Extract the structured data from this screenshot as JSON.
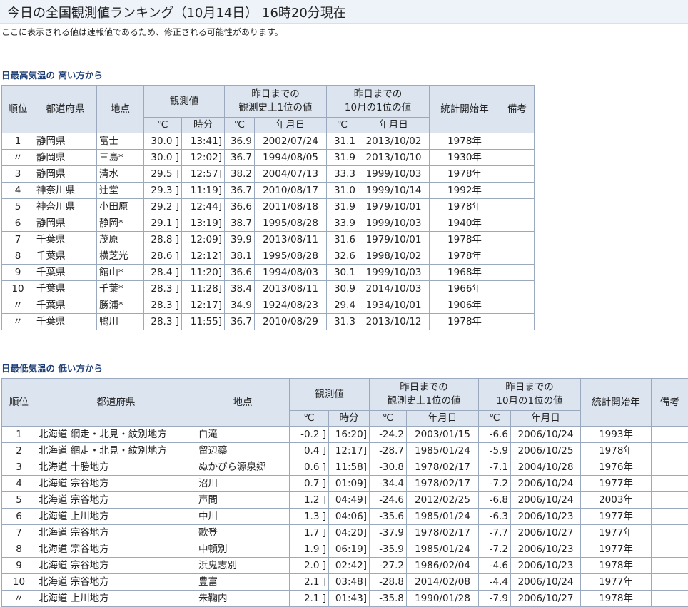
{
  "page": {
    "title": "今日の全国観測値ランキング（10月14日） 16時20分現在",
    "notice": "ここに表示される値は速報値であるため、修正される可能性があります。"
  },
  "headers": {
    "rank": "順位",
    "pref": "都道府県",
    "site": "地点",
    "obs": "観測値",
    "hist_line1": "昨日までの",
    "hist_line2": "観測史上1位の値",
    "oct_line1": "昨日までの",
    "oct_line2": "10月の1位の値",
    "start": "統計開始年",
    "notes": "備考",
    "deg": "℃",
    "time": "時分",
    "date": "年月日"
  },
  "high": {
    "heading": "日最高気温の 高い方から",
    "rows": [
      {
        "rank": "1",
        "pref": "静岡県",
        "site": "富士",
        "val": "30.0 ]",
        "time": "13:41]",
        "hist_val": "36.9",
        "hist_date": "2002/07/24",
        "oct_val": "31.1",
        "oct_date": "2013/10/02",
        "start": "1978年",
        "note": ""
      },
      {
        "rank": "〃",
        "pref": "静岡県",
        "site": "三島*",
        "val": "30.0 ]",
        "time": "12:02]",
        "hist_val": "36.7",
        "hist_date": "1994/08/05",
        "oct_val": "31.9",
        "oct_date": "2013/10/10",
        "start": "1930年",
        "note": ""
      },
      {
        "rank": "3",
        "pref": "静岡県",
        "site": "清水",
        "val": "29.5 ]",
        "time": "12:57]",
        "hist_val": "38.2",
        "hist_date": "2004/07/13",
        "oct_val": "33.3",
        "oct_date": "1999/10/03",
        "start": "1978年",
        "note": ""
      },
      {
        "rank": "4",
        "pref": "神奈川県",
        "site": "辻堂",
        "val": "29.3 ]",
        "time": "11:19]",
        "hist_val": "36.7",
        "hist_date": "2010/08/17",
        "oct_val": "31.0",
        "oct_date": "1999/10/14",
        "start": "1992年",
        "note": ""
      },
      {
        "rank": "5",
        "pref": "神奈川県",
        "site": "小田原",
        "val": "29.2 ]",
        "time": "12:44]",
        "hist_val": "36.6",
        "hist_date": "2011/08/18",
        "oct_val": "31.9",
        "oct_date": "1979/10/01",
        "start": "1978年",
        "note": ""
      },
      {
        "rank": "6",
        "pref": "静岡県",
        "site": "静岡*",
        "val": "29.1 ]",
        "time": "13:19]",
        "hist_val": "38.7",
        "hist_date": "1995/08/28",
        "oct_val": "33.9",
        "oct_date": "1999/10/03",
        "start": "1940年",
        "note": ""
      },
      {
        "rank": "7",
        "pref": "千葉県",
        "site": "茂原",
        "val": "28.8 ]",
        "time": "12:09]",
        "hist_val": "39.9",
        "hist_date": "2013/08/11",
        "oct_val": "31.6",
        "oct_date": "1979/10/01",
        "start": "1978年",
        "note": ""
      },
      {
        "rank": "8",
        "pref": "千葉県",
        "site": "横芝光",
        "val": "28.6 ]",
        "time": "12:12]",
        "hist_val": "38.1",
        "hist_date": "1995/08/28",
        "oct_val": "32.6",
        "oct_date": "1998/10/02",
        "start": "1978年",
        "note": ""
      },
      {
        "rank": "9",
        "pref": "千葉県",
        "site": "館山*",
        "val": "28.4 ]",
        "time": "11:20]",
        "hist_val": "36.6",
        "hist_date": "1994/08/03",
        "oct_val": "30.1",
        "oct_date": "1999/10/03",
        "start": "1968年",
        "note": ""
      },
      {
        "rank": "10",
        "pref": "千葉県",
        "site": "千葉*",
        "val": "28.3 ]",
        "time": "11:28]",
        "hist_val": "38.4",
        "hist_date": "2013/08/11",
        "oct_val": "30.9",
        "oct_date": "2014/10/03",
        "start": "1966年",
        "note": ""
      },
      {
        "rank": "〃",
        "pref": "千葉県",
        "site": "勝浦*",
        "val": "28.3 ]",
        "time": "12:17]",
        "hist_val": "34.9",
        "hist_date": "1924/08/23",
        "oct_val": "29.4",
        "oct_date": "1934/10/01",
        "start": "1906年",
        "note": ""
      },
      {
        "rank": "〃",
        "pref": "千葉県",
        "site": "鴨川",
        "val": "28.3 ]",
        "time": "11:55]",
        "hist_val": "36.7",
        "hist_date": "2010/08/29",
        "oct_val": "31.3",
        "oct_date": "2013/10/12",
        "start": "1978年",
        "note": ""
      }
    ]
  },
  "low": {
    "heading": "日最低気温の 低い方から",
    "rows": [
      {
        "rank": "1",
        "pref": "北海道 網走・北見・紋別地方",
        "site": "白滝",
        "val": "-0.2 ]",
        "time": "16:20]",
        "hist_val": "-24.2",
        "hist_date": "2003/01/15",
        "oct_val": "-6.6",
        "oct_date": "2006/10/24",
        "start": "1993年",
        "note": ""
      },
      {
        "rank": "2",
        "pref": "北海道 網走・北見・紋別地方",
        "site": "留辺蘂",
        "val": "0.4 ]",
        "time": "12:17]",
        "hist_val": "-28.7",
        "hist_date": "1985/01/24",
        "oct_val": "-5.9",
        "oct_date": "2006/10/25",
        "start": "1978年",
        "note": ""
      },
      {
        "rank": "3",
        "pref": "北海道 十勝地方",
        "site": "ぬかびら源泉郷",
        "val": "0.6 ]",
        "time": "11:58]",
        "hist_val": "-30.8",
        "hist_date": "1978/02/17",
        "oct_val": "-7.1",
        "oct_date": "2004/10/28",
        "start": "1976年",
        "note": ""
      },
      {
        "rank": "4",
        "pref": "北海道 宗谷地方",
        "site": "沼川",
        "val": "0.7 ]",
        "time": "01:09]",
        "hist_val": "-34.4",
        "hist_date": "1978/02/17",
        "oct_val": "-7.2",
        "oct_date": "2006/10/24",
        "start": "1977年",
        "note": ""
      },
      {
        "rank": "5",
        "pref": "北海道 宗谷地方",
        "site": "声問",
        "val": "1.2 ]",
        "time": "04:49]",
        "hist_val": "-24.6",
        "hist_date": "2012/02/25",
        "oct_val": "-6.8",
        "oct_date": "2006/10/24",
        "start": "2003年",
        "note": ""
      },
      {
        "rank": "6",
        "pref": "北海道 上川地方",
        "site": "中川",
        "val": "1.3 ]",
        "time": "04:06]",
        "hist_val": "-35.6",
        "hist_date": "1985/01/24",
        "oct_val": "-6.3",
        "oct_date": "2006/10/23",
        "start": "1977年",
        "note": ""
      },
      {
        "rank": "7",
        "pref": "北海道 宗谷地方",
        "site": "歌登",
        "val": "1.7 ]",
        "time": "04:20]",
        "hist_val": "-37.9",
        "hist_date": "1978/02/17",
        "oct_val": "-7.7",
        "oct_date": "2006/10/27",
        "start": "1977年",
        "note": ""
      },
      {
        "rank": "8",
        "pref": "北海道 宗谷地方",
        "site": "中頓別",
        "val": "1.9 ]",
        "time": "06:19]",
        "hist_val": "-35.9",
        "hist_date": "1985/01/24",
        "oct_val": "-7.2",
        "oct_date": "2006/10/23",
        "start": "1977年",
        "note": ""
      },
      {
        "rank": "9",
        "pref": "北海道 宗谷地方",
        "site": "浜鬼志別",
        "val": "2.0 ]",
        "time": "02:42]",
        "hist_val": "-27.2",
        "hist_date": "1986/02/04",
        "oct_val": "-4.6",
        "oct_date": "2006/10/23",
        "start": "1978年",
        "note": ""
      },
      {
        "rank": "10",
        "pref": "北海道 宗谷地方",
        "site": "豊富",
        "val": "2.1 ]",
        "time": "03:48]",
        "hist_val": "-28.8",
        "hist_date": "2014/02/08",
        "oct_val": "-4.4",
        "oct_date": "2006/10/24",
        "start": "1977年",
        "note": ""
      },
      {
        "rank": "〃",
        "pref": "北海道 上川地方",
        "site": "朱鞠内",
        "val": "2.1 ]",
        "time": "01:43]",
        "hist_val": "-35.8",
        "hist_date": "1990/01/28",
        "oct_val": "-7.9",
        "oct_date": "2006/10/27",
        "start": "1978年",
        "note": ""
      }
    ]
  }
}
